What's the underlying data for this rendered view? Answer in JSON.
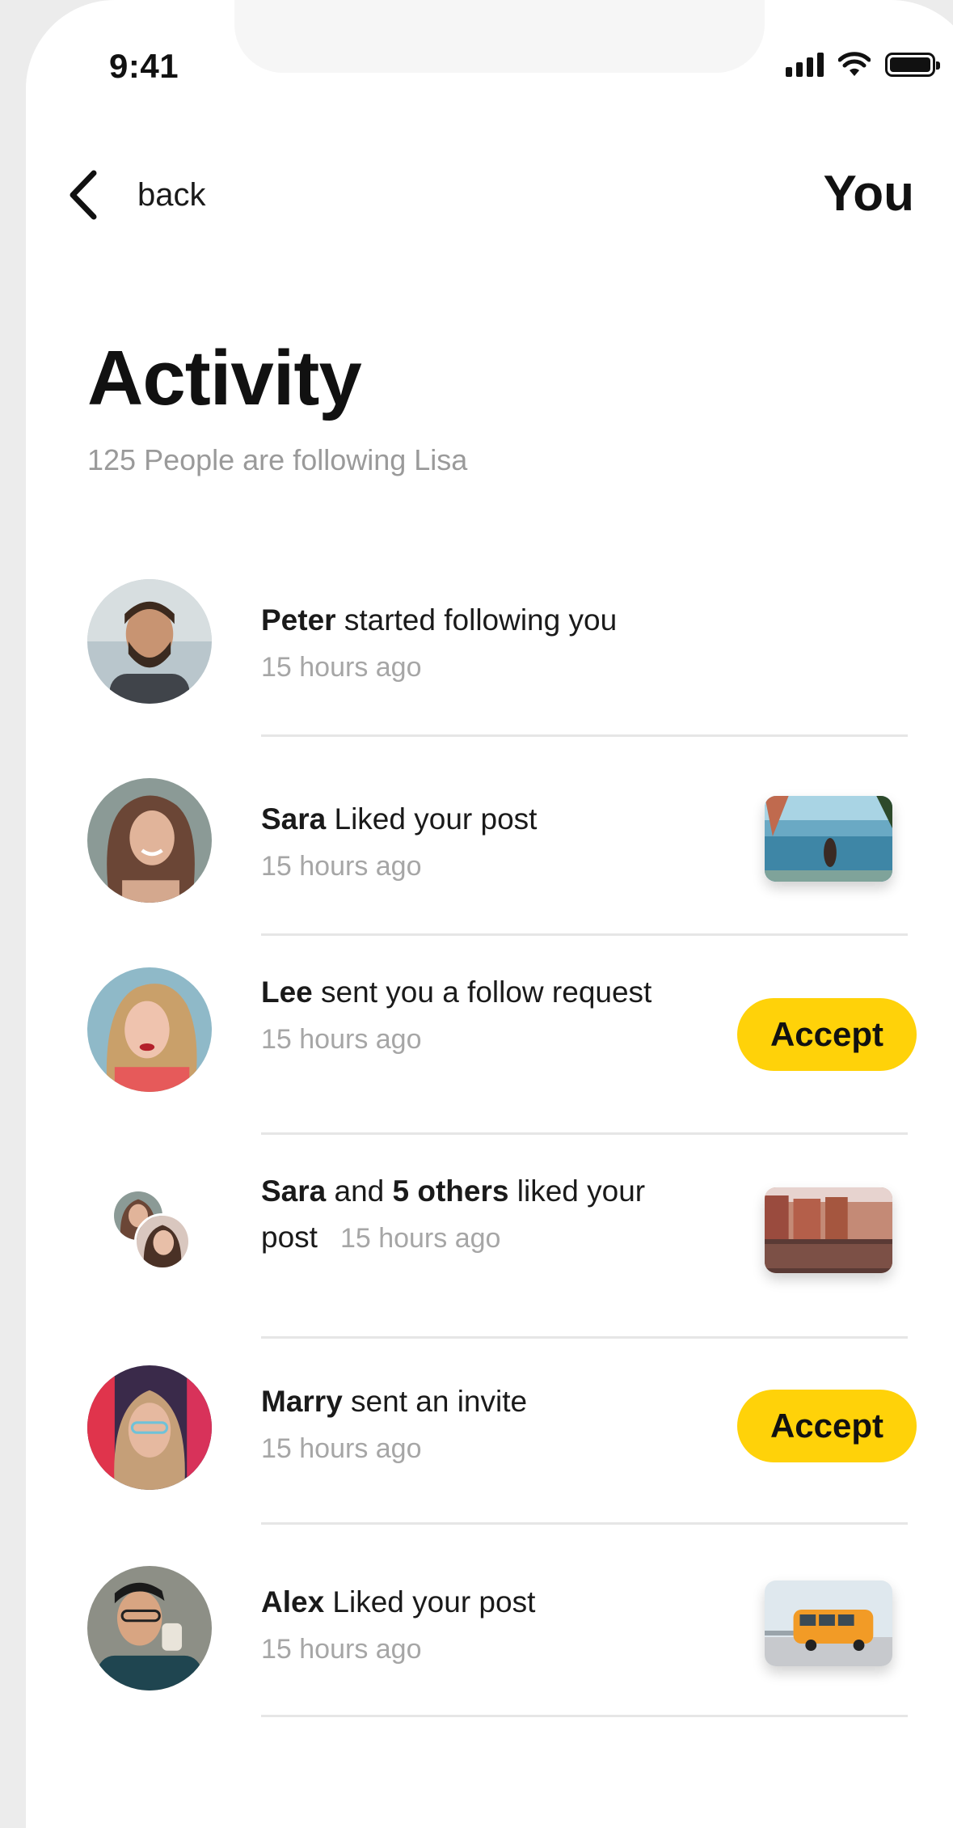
{
  "status": {
    "time": "9:41"
  },
  "nav": {
    "back_label": "back",
    "title": "You"
  },
  "header": {
    "title": "Activity",
    "subtitle": "125 People are following Lisa"
  },
  "colors": {
    "accent": "#FFD209",
    "muted": "#A6A6A6"
  },
  "activities": [
    {
      "name": "Peter",
      "text": " started following you",
      "time": "15 hours ago"
    },
    {
      "name": "Sara",
      "text": " Liked your post",
      "time": "15 hours ago",
      "thumb": "post-thumbnail"
    },
    {
      "name": "Lee",
      "text": " sent you a follow request",
      "time": "15 hours ago",
      "action": "Accept"
    },
    {
      "name": "Sara",
      "mid": " and ",
      "name2": "5 others",
      "text": " liked your",
      "text2": "post",
      "time": "15 hours ago",
      "thumb": "post-thumbnail"
    },
    {
      "name": "Marry",
      "text": " sent an invite",
      "time": "15 hours ago",
      "action": "Accept"
    },
    {
      "name": "Alex",
      "text": " Liked your post",
      "time": "15 hours ago",
      "thumb": "post-thumbnail"
    }
  ]
}
